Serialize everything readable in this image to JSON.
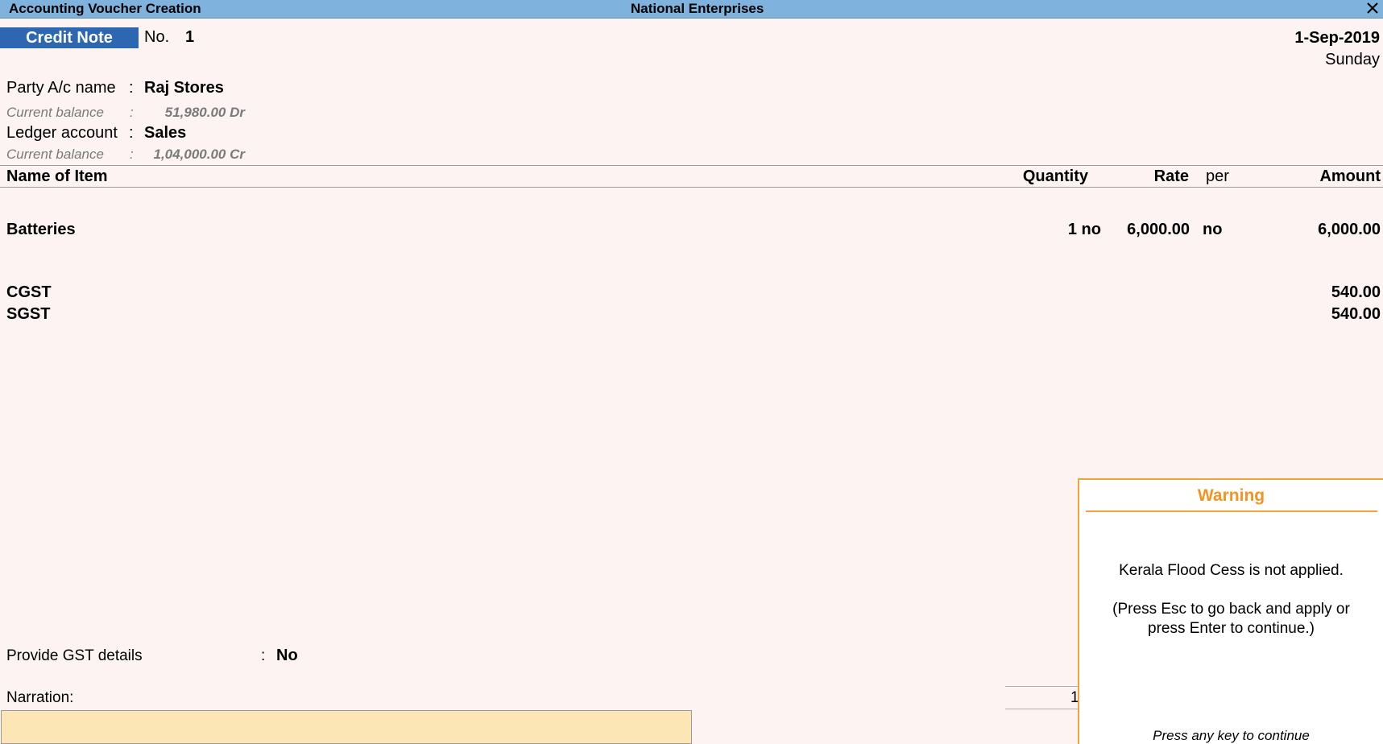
{
  "window": {
    "title": "Accounting Voucher Creation",
    "company": "National Enterprises",
    "close_icon": "close-icon"
  },
  "voucher": {
    "type": "Credit Note",
    "no_label": "No.",
    "no_value": "1",
    "date": "1-Sep-2019",
    "day": "Sunday"
  },
  "party": {
    "label": "Party A/c name",
    "sep": ":",
    "value": "Raj Stores",
    "balance_label": "Current balance",
    "balance_sep": ":",
    "balance_value": "51,980.00 Dr"
  },
  "ledger": {
    "label": "Ledger account",
    "sep": ":",
    "value": "Sales",
    "balance_label": "Current balance",
    "balance_sep": ":",
    "balance_value": "1,04,000.00 Cr"
  },
  "table": {
    "headers": {
      "name": "Name of Item",
      "quantity": "Quantity",
      "rate": "Rate",
      "per": "per",
      "amount": "Amount"
    },
    "items": [
      {
        "name": "Batteries",
        "quantity": "1 no",
        "rate": "6,000.00",
        "per": "no",
        "amount": "6,000.00"
      }
    ],
    "taxes": [
      {
        "name": "CGST",
        "amount": "540.00"
      },
      {
        "name": "SGST",
        "amount": "540.00"
      }
    ]
  },
  "gst": {
    "label": "Provide GST details",
    "sep": ":",
    "value": "No"
  },
  "narration": {
    "label": "Narration:",
    "total_partial": "1"
  },
  "warning": {
    "title": "Warning",
    "message": "Kerala Flood Cess is not applied.",
    "instruction_line1": "(Press Esc to go back and apply or",
    "instruction_line2": "press Enter to continue.)",
    "footer": "Press any key to continue"
  }
}
